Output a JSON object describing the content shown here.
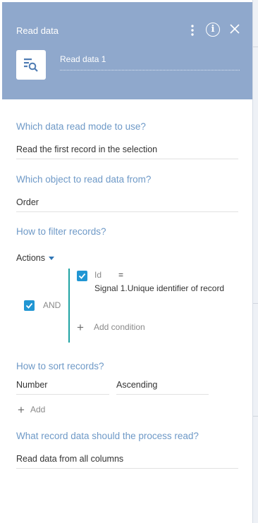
{
  "header": {
    "title": "Read data",
    "element_name": "Read data 1",
    "tile_icon": "read-data-icon",
    "more_icon": "vertical-dots-icon",
    "info_icon_glyph": "i",
    "close_icon": "close-icon",
    "background": "#8fa8cc"
  },
  "read_mode": {
    "question": "Which data read mode to use?",
    "value": "Read the first record in the selection"
  },
  "object": {
    "question": "Which object to read data from?",
    "value": "Order"
  },
  "filter": {
    "question": "How to filter records?",
    "actions_label": "Actions",
    "group_operator": "AND",
    "group_checked": true,
    "condition": {
      "checked": true,
      "column": "Id",
      "operator": "=",
      "value": "Signal 1.Unique identifier of record"
    },
    "add_condition_label": "Add condition"
  },
  "sort": {
    "question": "How to sort records?",
    "column": "Number",
    "direction": "Ascending",
    "add_label": "Add"
  },
  "columns": {
    "question": "What record data should the process read?",
    "value": "Read data from all columns"
  },
  "colors": {
    "question_text": "#6e99c7",
    "checkbox": "#2196d3",
    "bracket": "#1fa3a3"
  }
}
